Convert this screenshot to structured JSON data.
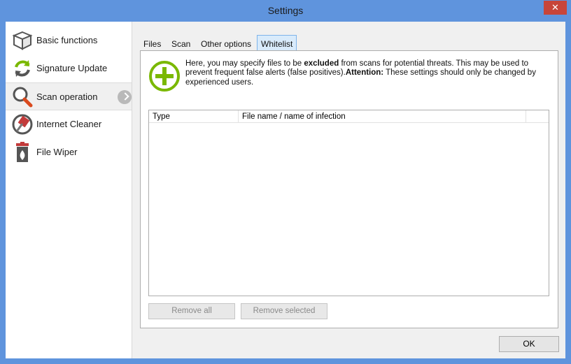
{
  "window": {
    "title": "Settings"
  },
  "sidebar": {
    "items": [
      {
        "label": "Basic functions",
        "icon": "box-icon"
      },
      {
        "label": "Signature Update",
        "icon": "refresh-icon"
      },
      {
        "label": "Scan operation",
        "icon": "magnifier-icon",
        "active": true
      },
      {
        "label": "Internet Cleaner",
        "icon": "broom-icon"
      },
      {
        "label": "File Wiper",
        "icon": "trash-fire-icon"
      }
    ]
  },
  "tabs": [
    {
      "label": "Files"
    },
    {
      "label": "Scan"
    },
    {
      "label": "Other options"
    },
    {
      "label": "Whitelist",
      "active": true
    }
  ],
  "info": {
    "part1": "Here, you may specify files to be ",
    "bold1": "excluded",
    "part2": " from scans for potential threats. This may be used to prevent frequent false alerts (false positives).",
    "bold2": "Attention:",
    "part3": " These settings should only be changed by experienced users."
  },
  "list": {
    "columns": [
      "Type",
      "File name / name of infection"
    ]
  },
  "buttons": {
    "remove_all": "Remove all",
    "remove_selected": "Remove selected",
    "ok": "OK"
  },
  "colors": {
    "titlebar": "#5f94dd",
    "close": "#c7453a",
    "accent_green": "#7ab800",
    "tab_active": "#d9ebfb"
  }
}
